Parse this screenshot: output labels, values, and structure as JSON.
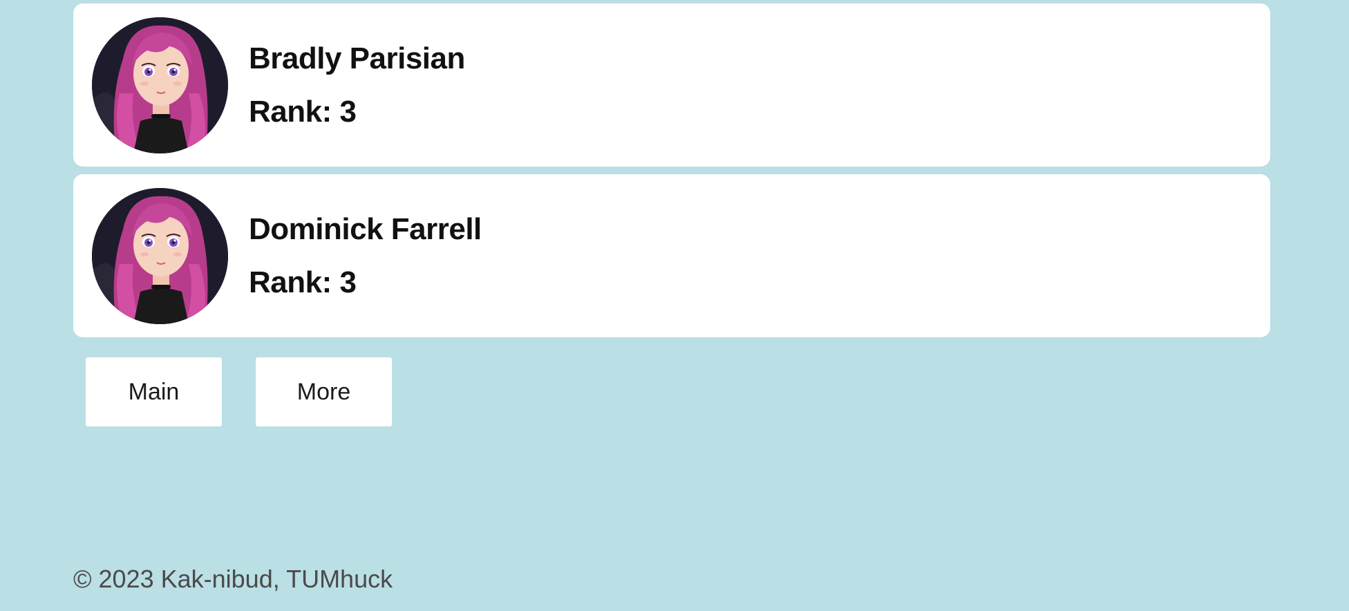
{
  "users": [
    {
      "name": "Bradly Parisian",
      "rank": "Rank: 3"
    },
    {
      "name": "Dominick Farrell",
      "rank": "Rank: 3"
    }
  ],
  "nav": {
    "main_label": "Main",
    "more_label": "More"
  },
  "footer": {
    "copyright": "© 2023 Kak-nibud, TUMhuck"
  },
  "colors": {
    "background": "#badfe4",
    "card": "#ffffff",
    "text": "#111111",
    "footer_text": "#4a4a4a"
  },
  "icons": {
    "avatar": "anime-girl-avatar"
  }
}
